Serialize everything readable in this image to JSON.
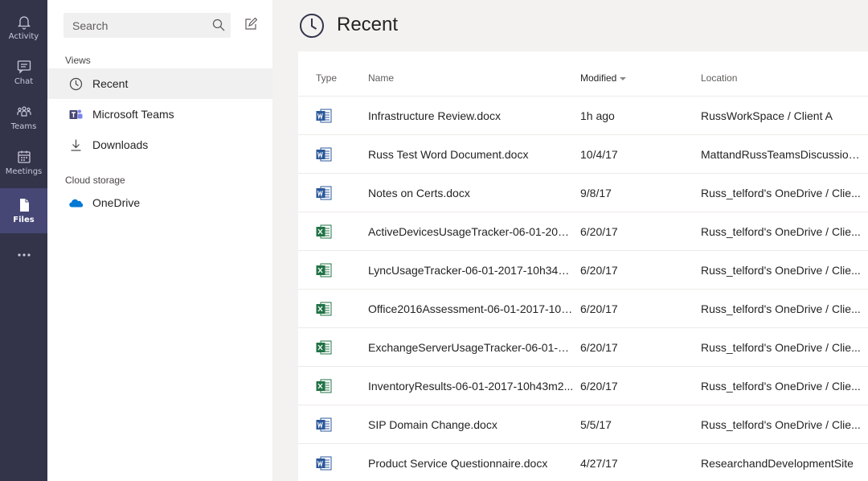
{
  "rail": {
    "items": [
      {
        "label": "Activity",
        "icon": "bell-icon"
      },
      {
        "label": "Chat",
        "icon": "chat-icon"
      },
      {
        "label": "Teams",
        "icon": "teams-icon"
      },
      {
        "label": "Meetings",
        "icon": "calendar-icon"
      },
      {
        "label": "Files",
        "icon": "file-icon",
        "active": true
      }
    ],
    "more": "more-icon"
  },
  "pane": {
    "search_placeholder": "Search",
    "views_label": "Views",
    "views": [
      {
        "label": "Recent",
        "icon": "clock-icon",
        "active": true
      },
      {
        "label": "Microsoft Teams",
        "icon": "teams-logo-icon"
      },
      {
        "label": "Downloads",
        "icon": "download-icon"
      }
    ],
    "cloud_label": "Cloud storage",
    "cloud": [
      {
        "label": "OneDrive",
        "icon": "onedrive-icon"
      }
    ]
  },
  "main": {
    "title": "Recent",
    "columns": {
      "type": "Type",
      "name": "Name",
      "modified": "Modified",
      "location": "Location"
    },
    "files": [
      {
        "type": "word",
        "name": "Infrastructure Review.docx",
        "modified": "1h ago",
        "location": "RussWorkSpace / Client A"
      },
      {
        "type": "word",
        "name": "Russ Test Word Document.docx",
        "modified": "10/4/17",
        "location": "MattandRussTeamsDiscussion..."
      },
      {
        "type": "word",
        "name": "Notes on Certs.docx",
        "modified": "9/8/17",
        "location": "Russ_telford's OneDrive / Clie..."
      },
      {
        "type": "excel",
        "name": "ActiveDevicesUsageTracker-06-01-2017...",
        "modified": "6/20/17",
        "location": "Russ_telford's OneDrive / Clie..."
      },
      {
        "type": "excel",
        "name": "LyncUsageTracker-06-01-2017-10h34m...",
        "modified": "6/20/17",
        "location": "Russ_telford's OneDrive / Clie..."
      },
      {
        "type": "excel",
        "name": "Office2016Assessment-06-01-2017-10h...",
        "modified": "6/20/17",
        "location": "Russ_telford's OneDrive / Clie..."
      },
      {
        "type": "excel",
        "name": "ExchangeServerUsageTracker-06-01-20...",
        "modified": "6/20/17",
        "location": "Russ_telford's OneDrive / Clie..."
      },
      {
        "type": "excel",
        "name": "InventoryResults-06-01-2017-10h43m2...",
        "modified": "6/20/17",
        "location": "Russ_telford's OneDrive / Clie..."
      },
      {
        "type": "word",
        "name": "SIP Domain Change.docx",
        "modified": "5/5/17",
        "location": "Russ_telford's OneDrive / Clie..."
      },
      {
        "type": "word",
        "name": "Product Service Questionnaire.docx",
        "modified": "4/27/17",
        "location": "ResearchandDevelopmentSite"
      }
    ]
  },
  "colors": {
    "rail": "#33344a",
    "rail_active": "#464775",
    "word": "#2b579a",
    "excel": "#217346",
    "onedrive": "#0078d4"
  }
}
